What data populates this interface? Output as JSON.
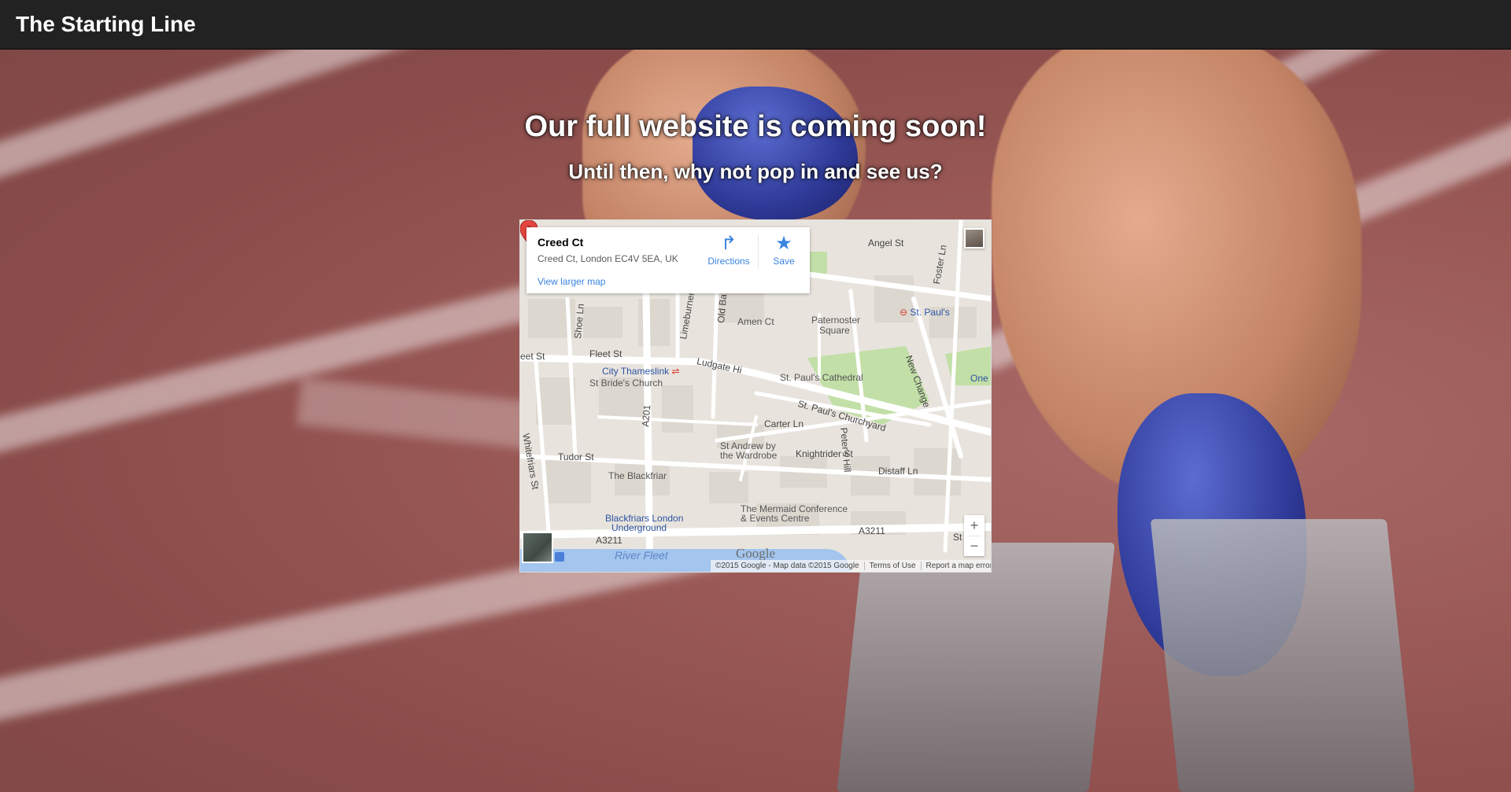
{
  "navbar": {
    "brand": "The Starting Line"
  },
  "hero": {
    "heading": "Our full website is coming soon!",
    "subheading": "Until then, why not pop in and see us?"
  },
  "map": {
    "place_title": "Creed Ct",
    "place_address": "Creed Ct, London EC4V 5EA, UK",
    "view_larger_label": "View larger map",
    "directions_label": "Directions",
    "save_label": "Save",
    "zoom_in": "+",
    "zoom_out": "−",
    "google_logo": "Google",
    "attribution": "©2015 Google - Map data ©2015 Google",
    "terms_label": "Terms of Use",
    "report_label": "Report a map error",
    "labels": {
      "angel_st": "Angel St",
      "foster_ln": "Foster Ln",
      "st_pauls": "St. Paul's",
      "amen_ct": "Amen Ct",
      "paternoster": "Paternoster",
      "paternoster2": "Square",
      "shoe_ln": "Shoe Ln",
      "old_ba": "Old Ba",
      "limeburner": "Limeburner",
      "fleet_st": "Fleet St",
      "eet_st": "eet St",
      "city_thameslink": "City Thameslink",
      "st_brides": "St Bride's Church",
      "ludgate": "Ludgate Hi",
      "st_pauls_cathedral": "St. Paul's Cathedral",
      "new_change": "New Change",
      "one": "One",
      "whitefriars": "Whitefriars St",
      "a201": "A201",
      "st_pauls_churchyard": "St. Paul's Churchyard",
      "carter_ln": "Carter Ln",
      "st_andrew": "St Andrew by",
      "st_andrew2": "the Wardrobe",
      "knightrider": "Knightrider St",
      "peters_hill": "Peter's Hill",
      "tudor_st": "Tudor St",
      "the_blackfriar": "The Blackfriar",
      "distaff": "Distaff Ln",
      "mermaid": "The Mermaid Conference",
      "mermaid2": "& Events Centre",
      "blackfriars": "Blackfriars London",
      "blackfriars2": "Underground",
      "a3211_left": "A3211",
      "a3211_right": "A3211",
      "river_fleet": "River Fleet",
      "st_edge": "St"
    }
  },
  "icons": {
    "directions": "directions-icon",
    "save": "star-icon",
    "pin": "map-pin-icon",
    "transit": "train-icon"
  },
  "colors": {
    "navbar_bg": "#222222",
    "link_blue": "#3a84df",
    "pin_red": "#e2463e",
    "park_green": "#c2dfa7"
  }
}
